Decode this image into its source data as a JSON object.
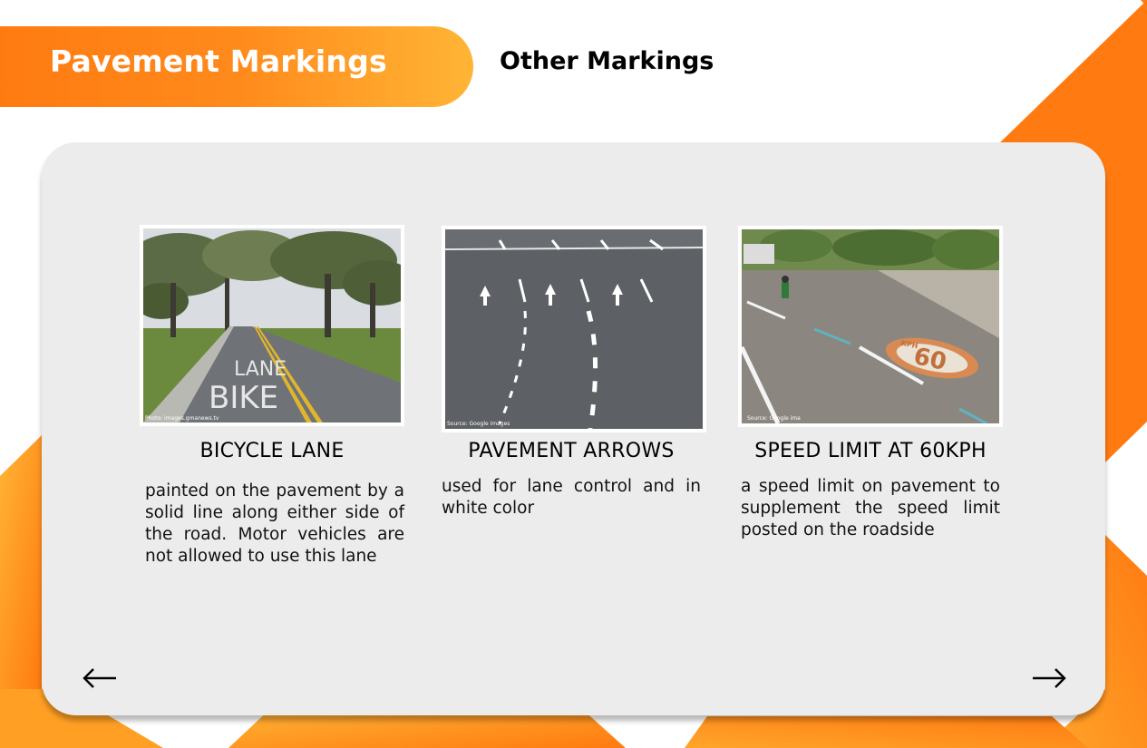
{
  "header": {
    "title": "Pavement Markings",
    "subtitle": "Other Markings"
  },
  "colors": {
    "accent_orange": "#ff7b12",
    "accent_yellow": "#ffb535",
    "card_background": "#ececec"
  },
  "items": [
    {
      "title": "BICYCLE LANE",
      "description": "painted on the pavement by a solid line along either side of the road. Motor vehicles are not allowed to use this lane",
      "photo_caption": "Photo: images.gmanews.tv",
      "pavement_text_top": "LANE",
      "pavement_text_bottom": "BIKE"
    },
    {
      "title": "PAVEMENT ARROWS",
      "description": "used for lane control and in white color",
      "photo_caption": "Source: Google images"
    },
    {
      "title": "SPEED LIMIT AT 60KPH",
      "description": "a speed limit on pavement to supplement the speed limit posted on the roadside",
      "photo_caption": "Source: Google ima",
      "pavement_number": "60",
      "pavement_prefix": "KPH"
    }
  ],
  "navigation": {
    "prev_icon": "arrow-left-icon",
    "next_icon": "arrow-right-icon"
  }
}
